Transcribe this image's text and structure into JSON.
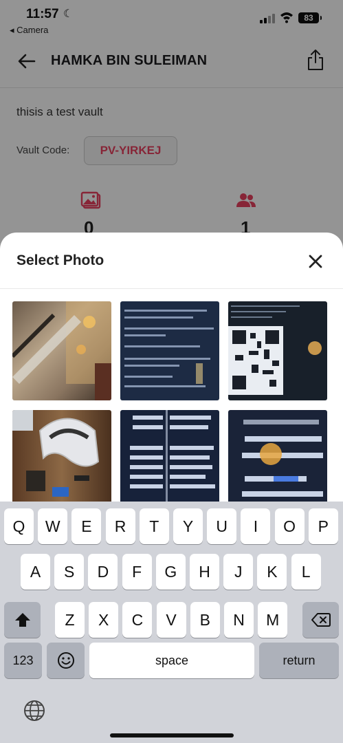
{
  "status_bar": {
    "time": "11:57",
    "back_app": "◂ Camera",
    "battery": "83"
  },
  "header": {
    "title": "HAMKA BIN SULEIMAN"
  },
  "vault": {
    "description": "thisis a test vault",
    "code_label": "Vault Code:",
    "code": "PV-YIRKEJ",
    "photo_count": "0",
    "member_count": "1"
  },
  "sheet": {
    "title": "Select Photo",
    "photos": [
      {
        "icon": "photo-escalator-lights"
      },
      {
        "icon": "photo-terminal-text"
      },
      {
        "icon": "photo-qr-code"
      },
      {
        "icon": "photo-headset-desk"
      },
      {
        "icon": "photo-terminal-commands"
      },
      {
        "icon": "photo-terminal-qr"
      }
    ]
  },
  "keyboard": {
    "row1": [
      "Q",
      "W",
      "E",
      "R",
      "T",
      "Y",
      "U",
      "I",
      "O",
      "P"
    ],
    "row2": [
      "A",
      "S",
      "D",
      "F",
      "G",
      "H",
      "J",
      "K",
      "L"
    ],
    "row3": [
      "Z",
      "X",
      "C",
      "V",
      "B",
      "N",
      "M"
    ],
    "numbers_label": "123",
    "space_label": "space",
    "return_label": "return"
  },
  "colors": {
    "accent": "#e8405f",
    "keyboard_bg": "#d1d3d9",
    "dim_overlay": "rgba(0,0,0,0.42)"
  }
}
